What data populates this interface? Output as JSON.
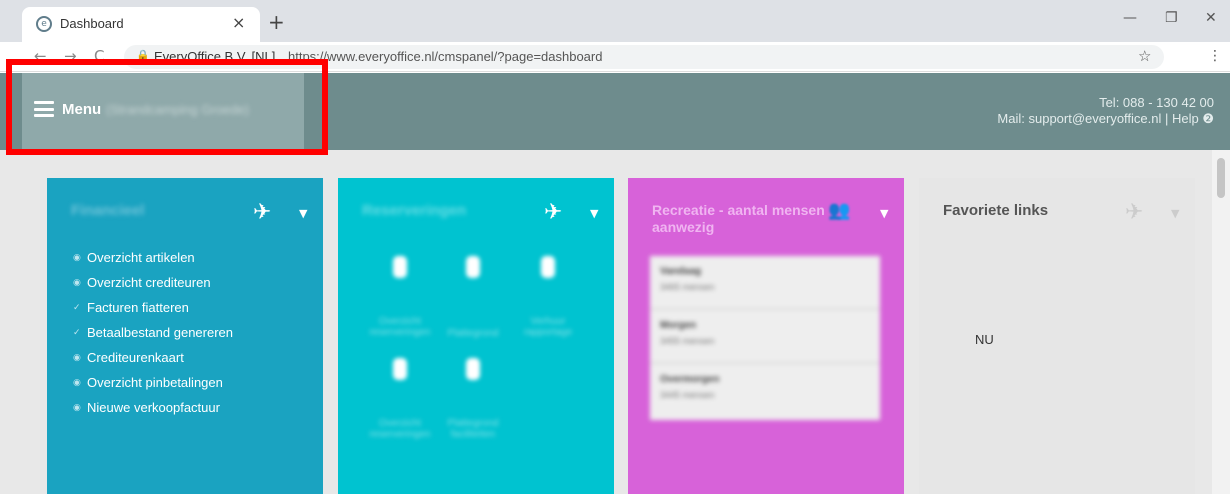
{
  "browser": {
    "tab_title": "Dashboard",
    "tab_close": "×",
    "new_tab": "+",
    "minimize": "—",
    "restore": "❐",
    "close": "✕",
    "back": "←",
    "forward": "→",
    "reload": "C",
    "lock": "🔒",
    "site_label": "EveryOffice B.V. [NL]",
    "url": "https://www.everyoffice.nl/cmspanel/?page=dashboard",
    "star": "☆",
    "kebab": "⋮"
  },
  "header": {
    "menu_label": "Menu",
    "menu_sub": "(Strandcamping Groede)",
    "tel": "Tel: 088 - 130 42 00",
    "mail": "Mail: support@everyoffice.nl | Help ❷"
  },
  "cards": {
    "financieel": {
      "title": "Financieel",
      "items": [
        "Overzicht artikelen",
        "Overzicht crediteuren",
        "Facturen fiatteren",
        "Betaalbestand genereren",
        "Crediteurenkaart",
        "Overzicht pinbetalingen",
        "Nieuwe verkoopfactuur"
      ]
    },
    "reserveringen": {
      "title": "Reserveringen",
      "labels": [
        "Overzicht reserveringen",
        "Plattegrond",
        "Verhuur rapportage",
        "Overzicht reserveringen",
        "Plattegrond faciliteiten"
      ]
    },
    "recreatie": {
      "title": "Recreatie - aantal mensen aanwezig",
      "rows": [
        {
          "day": "Vandaag",
          "count": "3465 mensen"
        },
        {
          "day": "Morgen",
          "count": "3455 mensen"
        },
        {
          "day": "Overmorgen",
          "count": "3445 mensen"
        }
      ]
    },
    "favoriete": {
      "title": "Favoriete links",
      "item": "NU"
    }
  },
  "icons": {
    "plane": "✈",
    "caret": "▼",
    "people": "👥"
  },
  "colors": {
    "header": "#6e8c8d",
    "financieel": "#1aa3c1",
    "reserveringen": "#00c3d0",
    "recreatie": "#d762d9",
    "favoriete": "#e6e6e6",
    "highlight": "#ff0000"
  }
}
